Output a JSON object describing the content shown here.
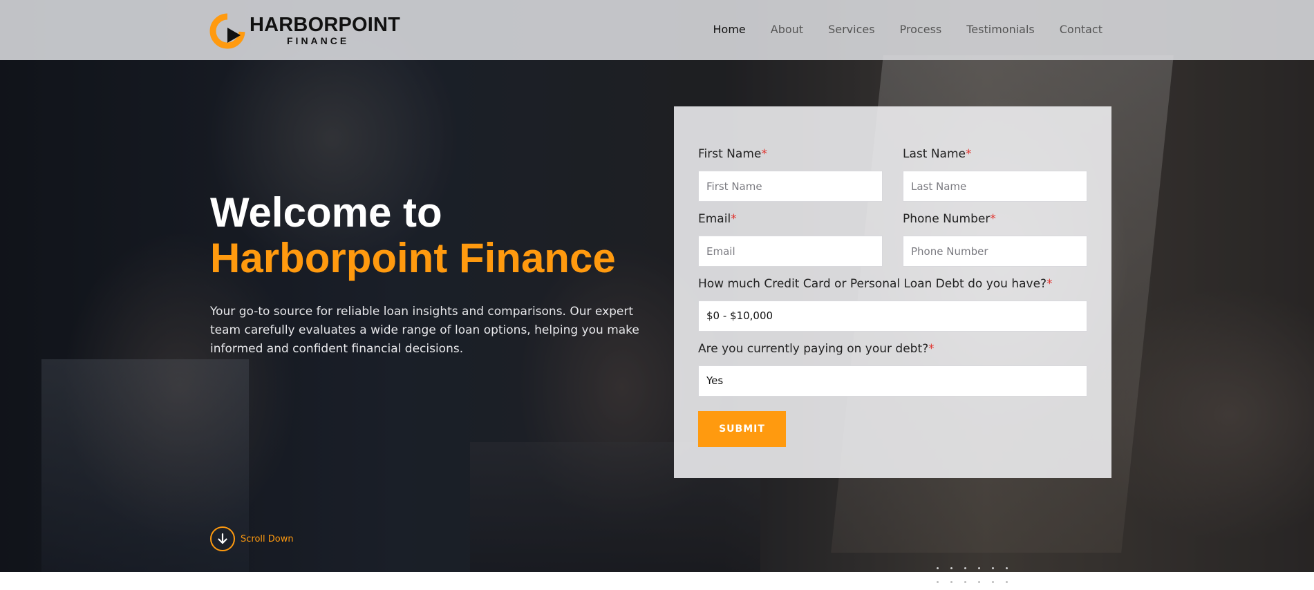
{
  "brand": {
    "name": "HARBORPOINT",
    "subtitle": "FINANCE",
    "accent_color": "#ff9a0f",
    "logo_icon": "play-circle-logo-icon"
  },
  "nav": {
    "items": [
      {
        "label": "Home",
        "active": true
      },
      {
        "label": "About",
        "active": false
      },
      {
        "label": "Services",
        "active": false
      },
      {
        "label": "Process",
        "active": false
      },
      {
        "label": "Testimonials",
        "active": false
      },
      {
        "label": "Contact",
        "active": false
      }
    ]
  },
  "hero": {
    "headline_line1": "Welcome to",
    "headline_line2": "Harborpoint Finance",
    "description": "Your go-to source for reliable loan insights and comparisons. Our expert team carefully evaluates a wide range of loan options, helping you make informed and confident financial decisions.",
    "scroll_label": "Scroll Down",
    "scroll_icon": "arrow-down-circle-icon"
  },
  "form": {
    "required_mark": "*",
    "first_name": {
      "label": "First Name",
      "placeholder": "First Name"
    },
    "last_name": {
      "label": "Last Name",
      "placeholder": "Last Name"
    },
    "email": {
      "label": "Email",
      "placeholder": "Email"
    },
    "phone": {
      "label": "Phone Number",
      "placeholder": "Phone Number"
    },
    "debt_amount": {
      "label": "How much Credit Card or Personal Loan Debt do you have?",
      "selected": "$0 - $10,000"
    },
    "paying_debt": {
      "label": "Are you currently paying on your debt?",
      "selected": "Yes"
    },
    "submit_label": "SUBMIT"
  }
}
